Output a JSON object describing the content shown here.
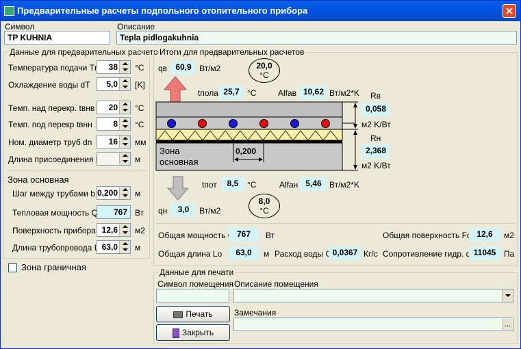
{
  "window": {
    "title": "Предварительные расчеты подпольного отопительного прибора",
    "close": "✕"
  },
  "top": {
    "symbol_label": "Символ",
    "symbol_value": "TP KUHNIA",
    "desc_label": "Описание",
    "desc_value": "Tepla pidlogakuhnia"
  },
  "left": {
    "caption": "Данные для предварительных расчетов",
    "rows": [
      {
        "label": "Температура подачи  Tп",
        "value": "38",
        "unit": "°C"
      },
      {
        "label": "Охлаждение воды dT",
        "value": "5,0",
        "unit": "[K]"
      },
      {
        "label": "Темп. над перекр. tвнв",
        "value": "20",
        "unit": "°C"
      },
      {
        "label": "Темп. под перекр tвнн",
        "value": "8",
        "unit": "°C"
      },
      {
        "label": "Ном. диаметр труб dn",
        "value": "16",
        "unit": "мм"
      },
      {
        "label": "Длина присоединения Lr",
        "value": "",
        "unit": "м"
      }
    ],
    "zone_title": "Зона основная",
    "zone_rows": [
      {
        "label": "Шаг между трубами b",
        "value": "0,200",
        "unit": "м"
      },
      {
        "label": "Тепловая мощность Qo",
        "value": "767",
        "unit": "Вт"
      },
      {
        "label": "Поверхность прибора F",
        "value": "12,6",
        "unit": "м2"
      },
      {
        "label": "Длина трубопровода L",
        "value": "63,0",
        "unit": "м"
      }
    ],
    "boundary_label": "Зона граничная"
  },
  "results": {
    "caption": "Итоги для предварительных расчетов",
    "qv_label": "qв",
    "qv": "60,9",
    "qv_unit": "Вт/м2",
    "t_top": "20,0",
    "t_top_unit": "°C",
    "tpola_label": "tпола",
    "tpola": "25,7",
    "tpola_unit": "°C",
    "alfav_label": "Alfaв",
    "alfav": "10,62",
    "alfav_unit": "Вт/м2*K",
    "rv_label": "Rв",
    "rv": "0,058",
    "rv_unit": "м2 K/Вт",
    "rn_label": "Rн",
    "rn": "2,368",
    "rn_unit": "м2 K/Вт",
    "zone_text1": "Зона",
    "zone_text2": "основная",
    "pitch": "0,200",
    "tpot_label": "tпот",
    "tpot": "8,5",
    "tpot_unit": "°C",
    "alfan_label": "Alfaн",
    "alfan": "5,46",
    "alfan_unit": "Вт/м2*K",
    "qn_label": "qн",
    "qn": "3,0",
    "qn_unit": "Вт/м2",
    "t_bot": "8,0",
    "t_bot_unit": "°C",
    "q_label": "Общая мощность Q",
    "q": "767",
    "q_unit": "Вт",
    "fo_label": "Общая поверхность Fo",
    "fo": "12,6",
    "fo_unit": "м2",
    "lo_label": "Общая длина Lo",
    "lo": "63,0",
    "lo_unit": "м",
    "g_label": "Расход воды G",
    "g": "0,0367",
    "g_unit": "Кг/с",
    "dp_label": "Сопротивление гидр. dP",
    "dp": "11045",
    "dp_unit": "Па"
  },
  "print": {
    "caption": "Данные для печати",
    "room_symbol_label": "Символ помещения",
    "room_desc_label": "Описание помещения",
    "notes_label": "Замечания",
    "print_btn": "Печать",
    "close_btn": "Закрыть",
    "browse": "..."
  },
  "colors": {
    "arrow_up": "#ee7a78",
    "arrow_down": "#bdbdbd",
    "pipe_blue": "#1a1ad8",
    "pipe_red": "#e01010",
    "insulation": "#f6f0a8"
  }
}
